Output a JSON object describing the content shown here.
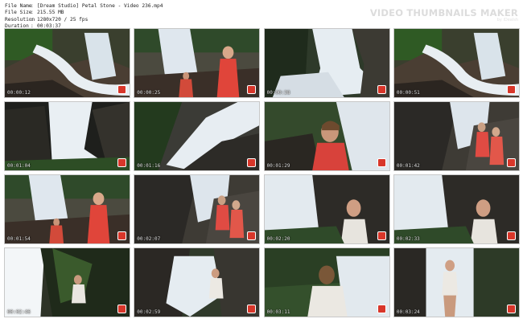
{
  "header": {
    "file_name_label": "File Name",
    "file_name_value": "[Dream Studio] Petal Stone - Video 236.mp4",
    "file_size_label": "File Size",
    "file_size_value": "215.55 MB",
    "resolution_label": "Resolution",
    "resolution_value": "1280x720 / 25 fps",
    "duration_label": "Duration",
    "duration_value": "00:03:37",
    "separator": ":",
    "brand": "VIDEO THUMBNAILS MAKER",
    "brand_sub": "by iDealsh"
  },
  "thumbnails": [
    {
      "time": "00:00:12",
      "scene": "falls-wide"
    },
    {
      "time": "00:00:25",
      "scene": "girls-red"
    },
    {
      "time": "00:00:38",
      "scene": "falls-tall"
    },
    {
      "time": "00:00:51",
      "scene": "falls-wide"
    },
    {
      "time": "00:01:04",
      "scene": "falls-dark"
    },
    {
      "time": "00:01:16",
      "scene": "falls-diagonal"
    },
    {
      "time": "00:01:29",
      "scene": "girl-closeup"
    },
    {
      "time": "00:01:42",
      "scene": "girls-rock"
    },
    {
      "time": "00:01:54",
      "scene": "girls-red"
    },
    {
      "time": "00:02:07",
      "scene": "girls-rock"
    },
    {
      "time": "00:02:20",
      "scene": "girl-white"
    },
    {
      "time": "00:02:33",
      "scene": "girl-white"
    },
    {
      "time": "00:02:46",
      "scene": "cave-bright"
    },
    {
      "time": "00:02:59",
      "scene": "falls-girl"
    },
    {
      "time": "00:03:11",
      "scene": "girl-back"
    },
    {
      "time": "00:03:24",
      "scene": "girl-stand"
    }
  ]
}
